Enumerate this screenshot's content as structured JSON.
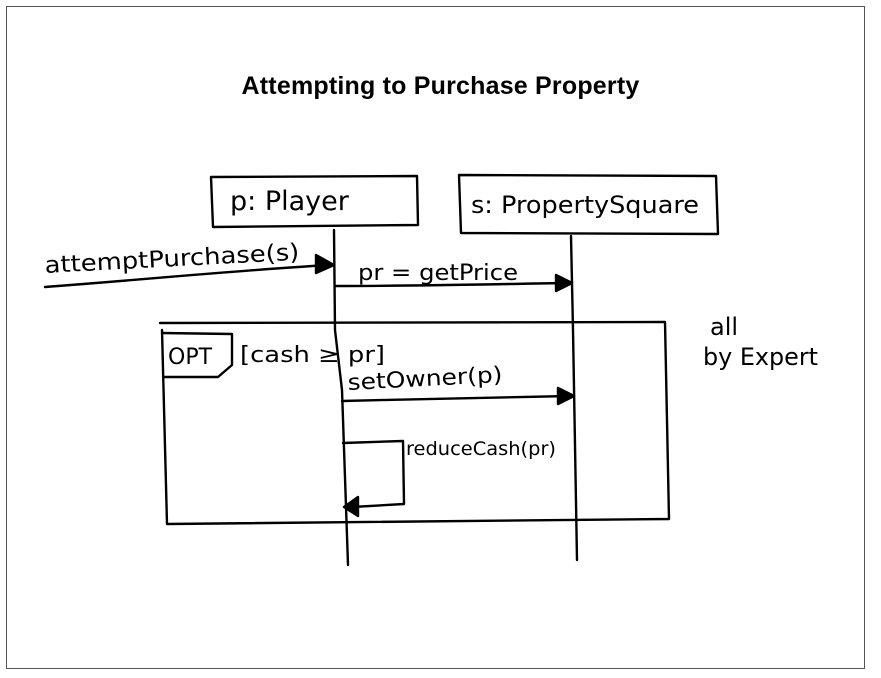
{
  "title": "Attempting to Purchase Property",
  "colors": {
    "ink": "#000000",
    "paper": "#ffffff",
    "frame": "#555555"
  },
  "diagram": {
    "type": "uml-sequence",
    "lifelines": [
      {
        "id": "player",
        "label": "p: Player"
      },
      {
        "id": "square",
        "label": "s: PropertySquare"
      }
    ],
    "messages": [
      {
        "label": "attemptPurchase(s)",
        "from": "external",
        "to": "player"
      },
      {
        "label": "pr = getPrice",
        "from": "player",
        "to": "square"
      },
      {
        "label": "setOwner(p)",
        "from": "player",
        "to": "square"
      },
      {
        "label": "reduceCash(pr)",
        "from": "player",
        "to": "player"
      }
    ],
    "fragment": {
      "operator": "OPT",
      "guard": "[cash ≥ pr]"
    },
    "note": {
      "line1": "all",
      "line2": "by Expert"
    }
  }
}
